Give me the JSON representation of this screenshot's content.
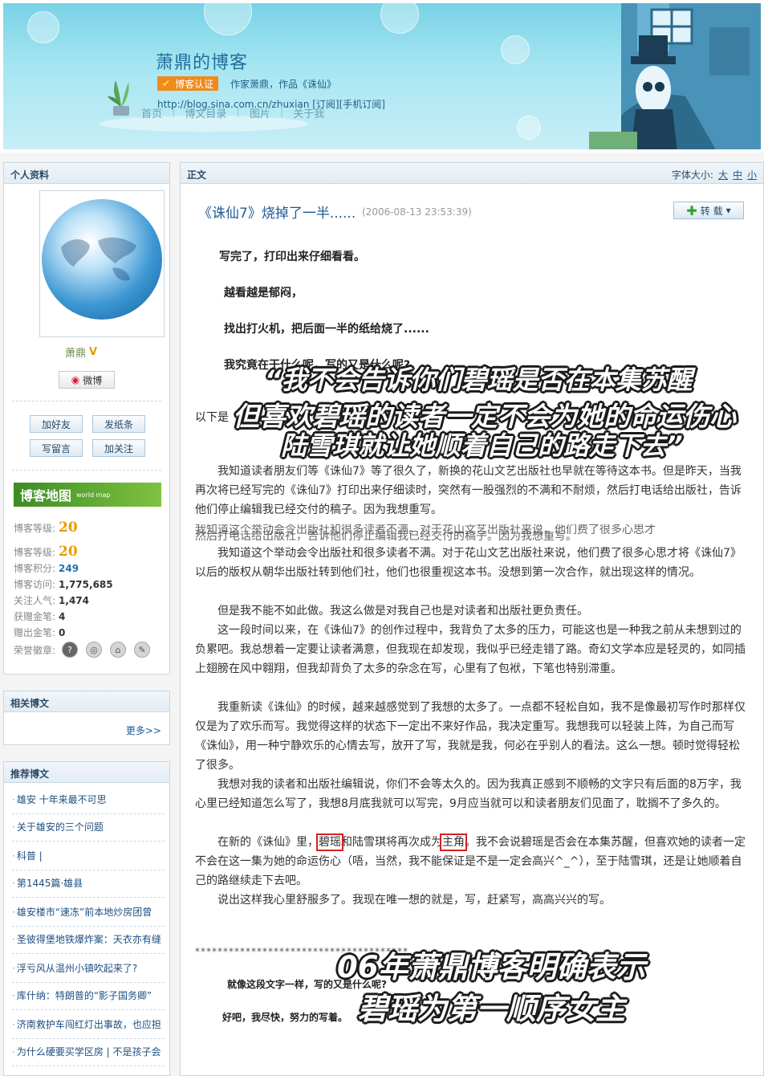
{
  "banner": {
    "title": "萧鼎的博客",
    "verify_label": "博客认证",
    "verify_desc": "作家萧鼎，作品《诛仙》",
    "url_line": "http://blog.sina.com.cn/zhuxian  [订阅][手机订阅]",
    "nav": [
      "首页",
      "博文目录",
      "图片",
      "关于我"
    ]
  },
  "profile": {
    "header": "个人资料",
    "name": "萧鼎",
    "weibo_label": "微博",
    "buttons": [
      "加好友",
      "发纸条",
      "写留言",
      "加关注"
    ],
    "map_label": "博客地图",
    "map_sub": "world map",
    "stats": [
      {
        "label": "博客等级:",
        "value": "20"
      },
      {
        "label": "博客等级:",
        "value": "20"
      },
      {
        "label": "博客积分:",
        "value": "249"
      },
      {
        "label": "博客访问:",
        "value": "1,775,685"
      },
      {
        "label": "关注人气:",
        "value": "1,474"
      },
      {
        "label": "获赠金笔:",
        "value": "4"
      },
      {
        "label": "赠出金笔:",
        "value": "0"
      },
      {
        "label": "荣誉徽章:",
        "value": ""
      }
    ]
  },
  "related": {
    "header": "相关博文",
    "more": "更多>>"
  },
  "recommend": {
    "header": "推荐博文",
    "items": [
      "雄安 十年来最不可思",
      "关于雄安的三个问题",
      "科普 |",
      "第1445篇·雄县",
      "雄安楼市“速冻”前本地炒房团曾",
      "圣彼得堡地铁爆炸案：天衣亦有缝",
      "浮亏风从温州小镇吹起来了?",
      "库什纳：特朗普的“影子国务卿”",
      "济南救护车闯红灯出事故，也应担",
      "为什么硬要买学区房 | 不是孩子会"
    ]
  },
  "article": {
    "section": "正文",
    "font_size_label": "字体大小:",
    "font_sizes": [
      "大",
      "中",
      "小"
    ],
    "title": "《诛仙7》烧掉了一半......",
    "date": "(2006-08-13 23:53:39)",
    "repost": "转 载",
    "intro_lines": [
      "写完了，打印出来仔细看看。",
      "越看越是郁闷，",
      "找出打火机，把后面一半的纸给烧了......",
      "我究竟在干什么呢，写的又是什么呢?"
    ],
    "intro_prefix": "以下是",
    "paragraphs": [
      "我知道读者朋友们等《诛仙7》等了很久了，新换的花山文艺出版社也早就在等待这本书。但是昨天，当我再次将已经写完的《诛仙7》打印出来仔细读时，突然有一股强烈的不满和不耐烦，然后打电话给出版社，告诉他们停止编辑我已经交付的稿子。因为我想重写。",
      "我知道这个举动会令出版社和很多读者不满。对于花山文艺出版社来说，他们费了很多心思才将《诛仙7》以后的版权从朝华出版社转到他们社，他们也很重视这本书。没想到第一次合作，就出现这样的情况。",
      "但是我不能不如此做。我这么做是对我自己也是对读者和出版社更负责任。",
      "这一段时间以来，在《诛仙7》的创作过程中，我背负了太多的压力，可能这也是一种我之前从未想到过的负累吧。我总想着一定要让读者满意，但我现在却发现，我似乎已经走错了路。奇幻文学本应是轻灵的，如同插上翅膀在风中翱翔，但我却背负了太多的杂念在写，心里有了包袱，下笔也特别滞重。",
      "我重新读《诛仙》的时候，越来越感觉到了我想的太多了。一点都不轻松自如，我不是像最初写作时那样仅仅是为了欢乐而写。我觉得这样的状态下一定出不来好作品，我决定重写。我想我可以轻装上阵，为自己而写《诛仙》，用一种宁静欢乐的心情去写，放开了写，我就是我，何必在乎别人的看法。这么一想。顿时觉得轻松了很多。",
      "我想对我的读者和出版社编辑说，你们不会等太久的。因为我真正感到不顺畅的文字只有后面的8万字，我心里已经知道怎么写了，我想8月底我就可以写完，9月应当就可以和读者朋友们见面了，耽搁不了多久的。"
    ],
    "ghost_line": "我知道这个举动会令出版社和很多读者不满。对于花山文艺出版社来说，他们费了很多心思才",
    "ghost_line2": "然后打电话给出版社，告诉他们停止编辑我已经交付的稿子。因为我想重写。",
    "p7_a": "在新的《诛仙》里，",
    "p7_hl1": "碧瑶",
    "p7_b": "和陆雪琪将再次成为",
    "p7_hl2": "主角",
    "p7_c": "。我不会说碧瑶是否会在本集苏醒，但喜欢她的读者一定不会在这一集为她的命运伤心（唔，当然，我不能保证是不是一定会高兴^_^），至于陆雪琪，还是让她顺着自己的路继续走下去吧。",
    "p8": "说出这样我心里舒服多了。我现在唯一想的就是，写，赶紧写，高高兴兴的写。",
    "stars": "**************************************",
    "end1": "就像这段文字一样，写的又是什么呢?",
    "end2": "好吧，我尽快，努力的写着。"
  },
  "captions": {
    "line1": "“我不会告诉你们碧瑶是否在本集苏醒",
    "line2": "但喜欢碧瑶的读者一定不会为她的命运伤心",
    "line3": "陆雪琪就让她顺着自己的路走下去”",
    "line4": "06年萧鼎博客明确表示",
    "line5": "碧瑶为第一顺序女主"
  }
}
